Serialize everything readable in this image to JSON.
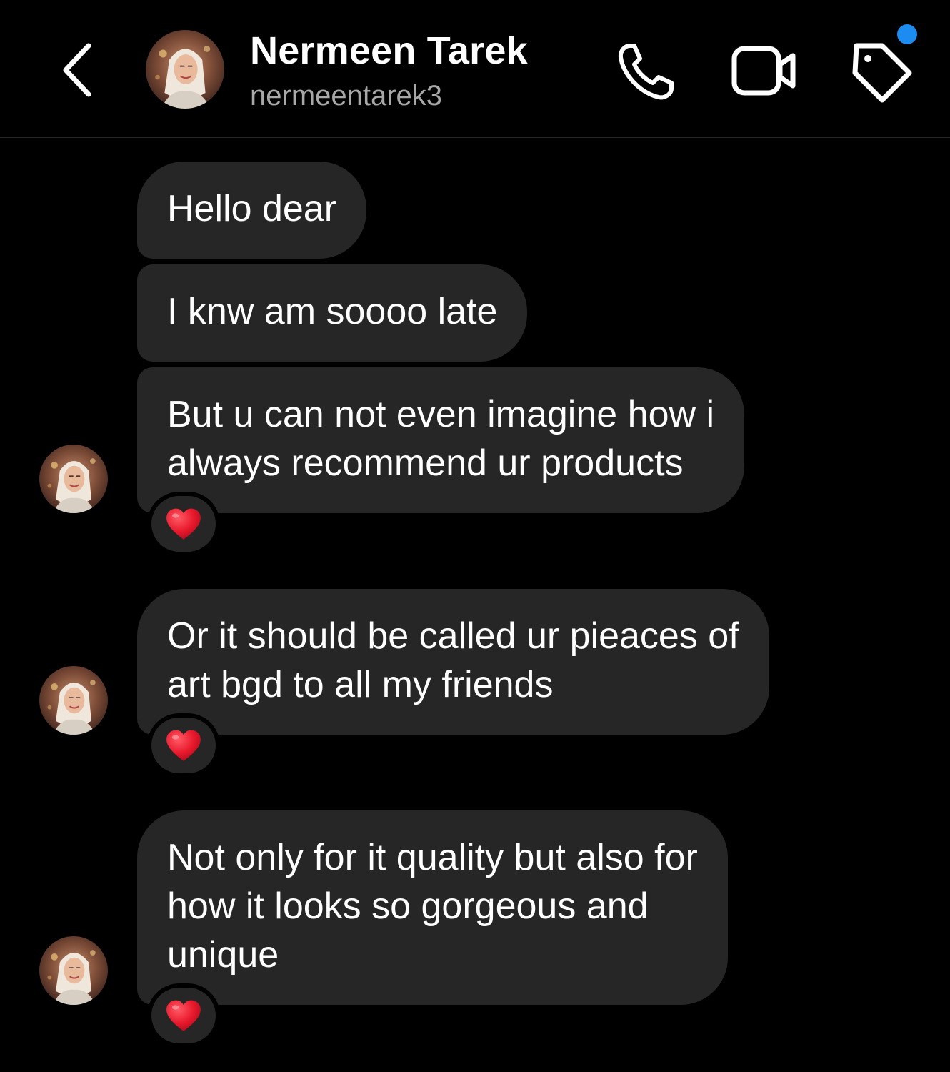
{
  "header": {
    "name": "Nermeen Tarek",
    "username": "nermeentarek3",
    "back_icon": "chevron-left-icon",
    "call_icon": "phone-icon",
    "video_icon": "video-camera-icon",
    "tag_icon": "tag-icon",
    "notification_dot_color": "#1d8cf0"
  },
  "colors": {
    "background": "#000000",
    "bubble": "#262626",
    "secondary_text": "#a8a8a8",
    "heart": "#e8192c"
  },
  "messages": [
    {
      "text": "Hello dear"
    },
    {
      "text": "I knw am soooo late"
    },
    {
      "lines": [
        "But u can not even imagine how i",
        "always recommend ur products"
      ],
      "reaction": "heart-icon"
    },
    {
      "lines": [
        "Or it should be called ur pieaces of",
        "art bgd to all my friends"
      ],
      "reaction": "heart-icon"
    },
    {
      "lines": [
        "Not only for it quality but also for",
        "how it looks so gorgeous and",
        "unique"
      ],
      "reaction": "heart-icon"
    }
  ]
}
